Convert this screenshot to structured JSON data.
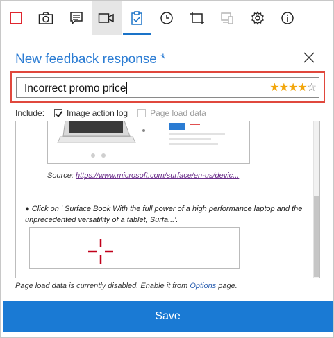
{
  "toolbar": {
    "items": [
      {
        "icon": "stop-record-icon"
      },
      {
        "icon": "camera-icon"
      },
      {
        "icon": "comment-icon"
      },
      {
        "icon": "video-camera-icon"
      },
      {
        "icon": "clipboard-check-icon"
      },
      {
        "icon": "clock-icon"
      },
      {
        "icon": "crop-icon"
      },
      {
        "icon": "device-icon"
      },
      {
        "icon": "gear-icon"
      },
      {
        "icon": "info-icon"
      }
    ],
    "accent": "#1a73c8"
  },
  "dialog": {
    "title": "New feedback response *",
    "title_color": "#2b7cd3"
  },
  "feedback": {
    "value": "Incorrect promo price",
    "rating": 4,
    "max_rating": 5
  },
  "include": {
    "label": "Include:",
    "options": [
      {
        "label": "Image action log",
        "checked": true,
        "enabled": true
      },
      {
        "label": "Page load data",
        "checked": false,
        "enabled": false
      }
    ]
  },
  "preview": {
    "source_label": "Source:",
    "source_link": "https://www.microsoft.com/surface/en-us/devic...",
    "step_text": "● Click on ' Surface Book With the full power of a high performance laptop and the unprecedented versatility of a tablet, Surfa...'."
  },
  "note": {
    "prefix": "Page load data is currently disabled. Enable it from ",
    "link": "Options",
    "suffix": " page."
  },
  "save_label": "Save",
  "highlight_color": "#e0483d",
  "save_color": "#1a7ad4"
}
